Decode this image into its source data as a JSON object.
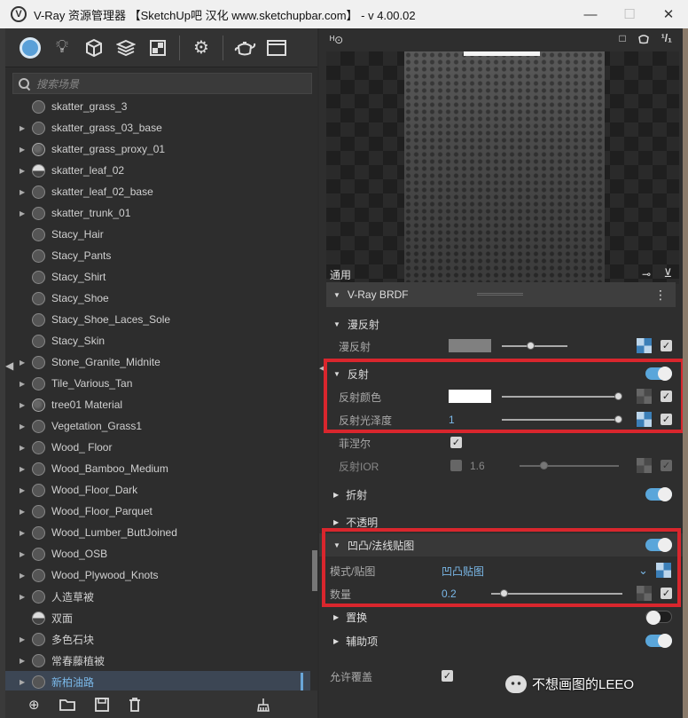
{
  "window": {
    "title": "V-Ray 资源管理器 【SketchUp吧 汉化 www.sketchupbar.com】 - v 4.00.02",
    "app_icon": "vray-logo-icon",
    "buttons": {
      "minimize": "—",
      "maximize": "☐",
      "close": "✕"
    }
  },
  "toolbar": {
    "items": [
      "materials-icon",
      "lights-icon",
      "geometry-icon",
      "layers-icon",
      "render-elements-icon",
      "settings-icon",
      "teapot-icon",
      "frame-buffer-icon"
    ]
  },
  "search": {
    "placeholder": "搜索场景"
  },
  "materials": [
    {
      "name": "skatter_grass_3",
      "expand": false,
      "swatch": "dark"
    },
    {
      "name": "skatter_grass_03_base",
      "expand": true,
      "swatch": "dark"
    },
    {
      "name": "skatter_grass_proxy_01",
      "expand": true,
      "swatch": "proxy"
    },
    {
      "name": "skatter_leaf_02",
      "expand": true,
      "swatch": "half"
    },
    {
      "name": "skatter_leaf_02_base",
      "expand": true,
      "swatch": "dark"
    },
    {
      "name": "skatter_trunk_01",
      "expand": true,
      "swatch": "dark"
    },
    {
      "name": "Stacy_Hair",
      "expand": false,
      "swatch": "dark"
    },
    {
      "name": "Stacy_Pants",
      "expand": false,
      "swatch": "dark"
    },
    {
      "name": "Stacy_Shirt",
      "expand": false,
      "swatch": "dark"
    },
    {
      "name": "Stacy_Shoe",
      "expand": false,
      "swatch": "dark"
    },
    {
      "name": "Stacy_Shoe_Laces_Sole",
      "expand": false,
      "swatch": "dark"
    },
    {
      "name": "Stacy_Skin",
      "expand": false,
      "swatch": "dark"
    },
    {
      "name": "Stone_Granite_Midnite",
      "expand": true,
      "swatch": "dark"
    },
    {
      "name": "Tile_Various_Tan",
      "expand": true,
      "swatch": "dark"
    },
    {
      "name": "tree01 Material",
      "expand": true,
      "swatch": "proxy"
    },
    {
      "name": "Vegetation_Grass1",
      "expand": true,
      "swatch": "dark"
    },
    {
      "name": "Wood_ Floor",
      "expand": true,
      "swatch": "dark"
    },
    {
      "name": "Wood_Bamboo_Medium",
      "expand": true,
      "swatch": "dark"
    },
    {
      "name": "Wood_Floor_Dark",
      "expand": true,
      "swatch": "dark"
    },
    {
      "name": "Wood_Floor_Parquet",
      "expand": true,
      "swatch": "dark"
    },
    {
      "name": "Wood_Lumber_ButtJoined",
      "expand": true,
      "swatch": "dark"
    },
    {
      "name": "Wood_OSB",
      "expand": true,
      "swatch": "dark"
    },
    {
      "name": "Wood_Plywood_Knots",
      "expand": true,
      "swatch": "dark"
    },
    {
      "name": "人造草被",
      "expand": true,
      "swatch": "dark"
    },
    {
      "name": "双面",
      "expand": false,
      "swatch": "half"
    },
    {
      "name": "多色石块",
      "expand": true,
      "swatch": "dark"
    },
    {
      "name": "常春藤植被",
      "expand": true,
      "swatch": "dark"
    },
    {
      "name": "新柏油路",
      "expand": true,
      "swatch": "dark",
      "selected": true
    }
  ],
  "list_scroll_fraction": 0.82,
  "bottom_toolbar": [
    "add-material-icon",
    "open-folder-icon",
    "save-icon",
    "delete-icon",
    "purge-icon"
  ],
  "preview": {
    "left_icon": "ᴴ⊙",
    "right_icons": [
      "□",
      "teapot",
      "1/1"
    ]
  },
  "panel": {
    "general_label": "通用",
    "brdf_label": "V-Ray BRDF",
    "diffuse": {
      "section_label": "漫反射",
      "row_label": "漫反射",
      "color": "#808080",
      "amount": 0.2,
      "map_checked": true
    },
    "reflection": {
      "section_label": "反射",
      "enabled": true,
      "color_label": "反射颜色",
      "color": "#ffffff",
      "color_amount": 1.0,
      "gloss_label": "反射光泽度",
      "gloss_value": "1",
      "gloss_amount": 1.0,
      "fresnel_label": "菲涅尔",
      "fresnel_checked": true,
      "ior_label": "反射IOR",
      "ior_value": "1.6",
      "ior_amount": 0.25
    },
    "refraction": {
      "section_label": "折射",
      "enabled": true
    },
    "opacity": {
      "section_label": "不透明"
    },
    "bump": {
      "section_label": "凹凸/法线贴图",
      "enabled": true,
      "mode_label": "模式/贴图",
      "mode_value": "凹凸贴图",
      "amount_label": "数量",
      "amount_value": "0.2",
      "amount_fraction": 0.1
    },
    "displacement": {
      "section_label": "置换",
      "enabled": false
    },
    "auxiliary": {
      "section_label": "辅助项",
      "enabled": true
    },
    "allow_override": {
      "label": "允许覆盖",
      "checked": true
    }
  },
  "watermark": {
    "text": "不想画图的LEEO"
  },
  "colors": {
    "accent": "#5aa6da",
    "highlight_box": "#d9262d",
    "link_text": "#7ab8e8"
  }
}
